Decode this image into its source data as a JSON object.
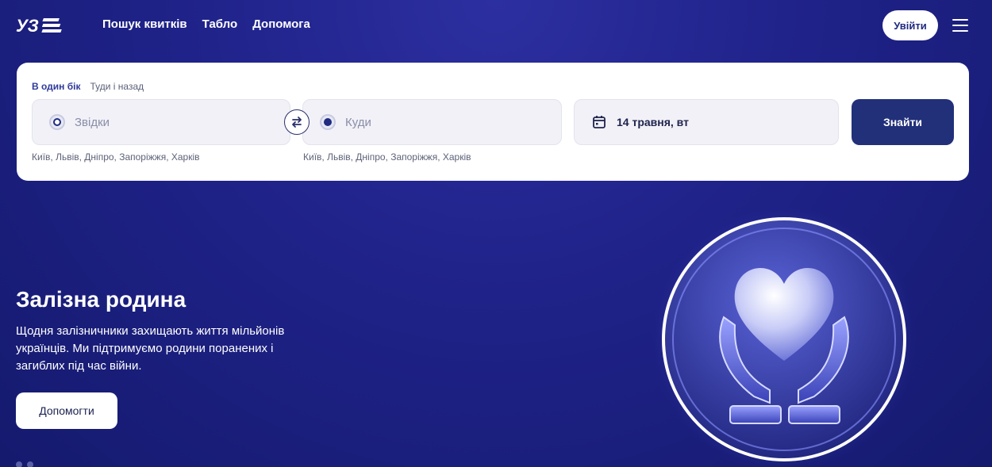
{
  "header": {
    "logo_text": "УЗ",
    "nav": [
      {
        "label": "Пошук квитків"
      },
      {
        "label": "Табло"
      },
      {
        "label": "Допомога"
      }
    ],
    "login_label": "Увійти"
  },
  "search": {
    "tabs": [
      {
        "label": "В один бік",
        "active": true
      },
      {
        "label": "Туди і назад",
        "active": false
      }
    ],
    "from_placeholder": "Звідки",
    "to_placeholder": "Куди",
    "date_value": "14 травня, вт",
    "find_label": "Знайти",
    "from_hint": "Київ, Львів, Дніпро, Запоріжжя, Харків",
    "to_hint": "Київ, Львів, Дніпро, Запоріжжя, Харків"
  },
  "hero": {
    "title": "Залізна родина",
    "text": "Щодня залізничники захищають життя мільйонів українців. Ми підтримуємо родини поранених і загиблих під час війни.",
    "button_label": "Допомогти"
  },
  "colors": {
    "brand_dark": "#22307a",
    "background": "#1f2288",
    "card": "#ffffff"
  },
  "icons": [
    "uz-logo-icon",
    "menu-icon",
    "radio-icon",
    "swap-arrows-icon",
    "calendar-icon",
    "heart-hands-icon"
  ]
}
